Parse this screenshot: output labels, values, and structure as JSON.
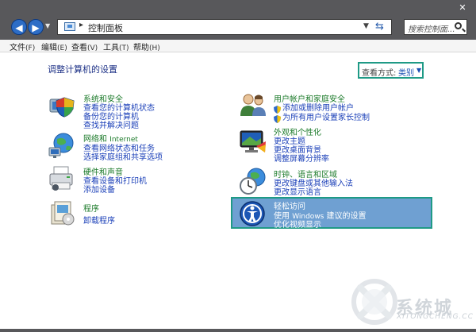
{
  "window": {
    "close_glyph": "✕",
    "address": {
      "separator": "▸",
      "path": "控制面板"
    },
    "search": {
      "placeholder": "搜索控制面..."
    }
  },
  "menubar": [
    {
      "label": "文件",
      "accel": "(F)"
    },
    {
      "label": "编辑",
      "accel": "(E)"
    },
    {
      "label": "查看",
      "accel": "(V)"
    },
    {
      "label": "工具",
      "accel": "(T)"
    },
    {
      "label": "帮助",
      "accel": "(H)"
    }
  ],
  "page": {
    "title": "调整计算机的设置",
    "view_by_label": "查看方式:",
    "view_by_value": "类别"
  },
  "categories": {
    "system_security": {
      "title": "系统和安全",
      "icon": "shield-computer-icon",
      "links": [
        "查看您的计算机状态",
        "备份您的计算机",
        "查找并解决问题"
      ]
    },
    "network_internet": {
      "title": "网络和",
      "title_en": "Internet",
      "icon": "globe-network-icon",
      "links": [
        "查看网络状态和任务",
        "选择家庭组和共享选项"
      ]
    },
    "hardware_sound": {
      "title": "硬件和声音",
      "icon": "printer-icon",
      "links": [
        "查看设备和打印机",
        "添加设备"
      ]
    },
    "programs": {
      "title": "程序",
      "icon": "programs-box-icon",
      "links": [
        "卸载程序"
      ]
    },
    "user_accounts": {
      "title": "用户帐户和家庭安全",
      "icon": "users-icon",
      "links": [
        "添加或删除用户帐户",
        "为所有用户设置家长控制"
      ]
    },
    "appearance": {
      "title": "外观和个性化",
      "icon": "monitor-palette-icon",
      "links": [
        "更改主题",
        "更改桌面背景",
        "调整屏幕分辨率"
      ]
    },
    "clock_language": {
      "title": "时钟、语言和区域",
      "icon": "clock-globe-icon",
      "links": [
        "更改键盘或其他输入法",
        "更改显示语言"
      ]
    },
    "ease_of_access": {
      "title": "轻松访问",
      "icon": "ease-of-access-icon",
      "links_prefix": "使用 ",
      "links_brand": "Windows",
      "links_suffix": " 建议的设置",
      "links2": "优化视频显示"
    }
  },
  "watermark": {
    "text": "系统城",
    "url": "XITONGCHENG.CC"
  },
  "colors": {
    "accent_teal": "#1f9a86",
    "link_blue": "#1a3fb8",
    "category_green": "#1d7b2b",
    "title_bar": "#58585b"
  }
}
